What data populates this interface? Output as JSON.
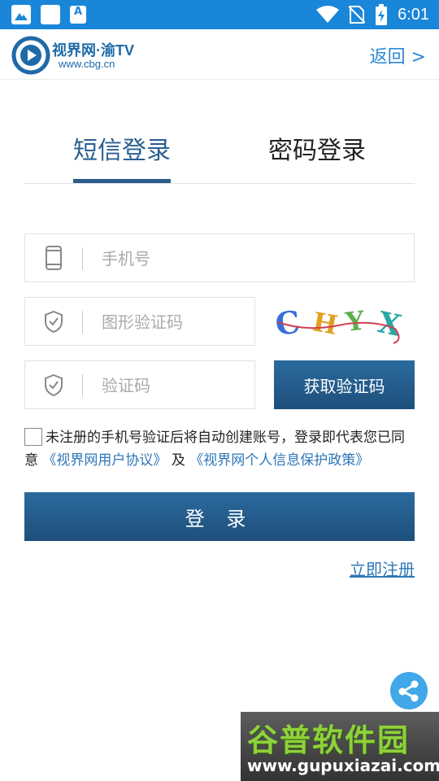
{
  "status_bar": {
    "notification_icons": [
      "gallery-icon",
      "square-icon",
      "font-icon"
    ],
    "font_icon_letter": "A",
    "time": "6:01",
    "system_icons": [
      "wifi-icon",
      "no-sim-icon",
      "battery-charging-icon"
    ]
  },
  "header": {
    "logo_name": "视界网·渝TV",
    "logo_url": "www.cbg.cn",
    "back_label": "返回 >"
  },
  "tabs": [
    {
      "label": "短信登录",
      "active": true
    },
    {
      "label": "密码登录",
      "active": false
    }
  ],
  "form": {
    "phone_placeholder": "手机号",
    "image_captcha_placeholder": "图形验证码",
    "captcha_text": "CHYX",
    "sms_code_placeholder": "验证码",
    "get_code_label": "获取验证码",
    "agreement_text": "未注册的手机号验证后将自动创建账号，登录即代表您已同意",
    "user_agreement_link": "《视界网用户协议》",
    "and_text": "及",
    "privacy_link": "《视界网个人信息保护政策》",
    "login_label": "登 录",
    "register_label": "立即注册"
  },
  "watermark": {
    "big_text": "谷普软件园",
    "url": "www.gupuxiazai.com"
  },
  "colors": {
    "status_bar": "#1a86d9",
    "primary_button": "#245d8f",
    "active_tab": "#2a5f93",
    "link": "#2e77b8",
    "fab": "#40a7e8"
  }
}
